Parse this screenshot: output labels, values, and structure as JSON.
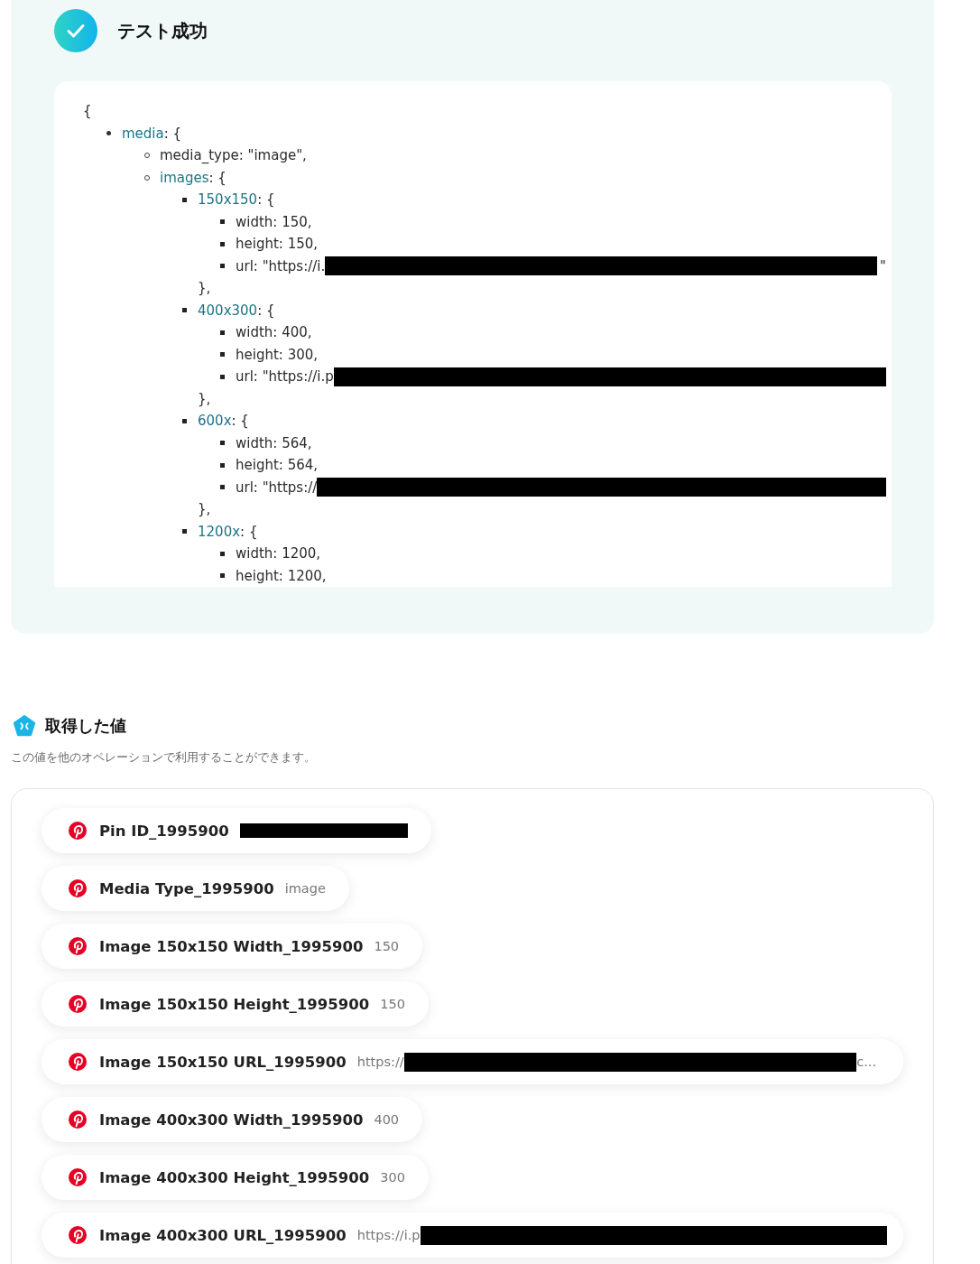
{
  "result": {
    "status_title": "テスト成功",
    "code": {
      "open": "{",
      "items": [
        {
          "key": "media",
          "text": ": {",
          "redacted": false,
          "children": [
            {
              "text": "media_type: \"image\",",
              "redacted": false
            },
            {
              "key": "images",
              "text": ": {",
              "redacted": false,
              "children": [
                {
                  "key": "150x150",
                  "text": ": {",
                  "redacted": false,
                  "close": "},",
                  "children": [
                    {
                      "text": "width: 150,",
                      "redacted": false
                    },
                    {
                      "text": "height: 150,",
                      "redacted": false
                    },
                    {
                      "text": "url: \"https://i.",
                      "redacted": true,
                      "suffix": "\""
                    }
                  ]
                },
                {
                  "key": "400x300",
                  "text": ": {",
                  "redacted": false,
                  "close": "},",
                  "children": [
                    {
                      "text": "width: 400,",
                      "redacted": false
                    },
                    {
                      "text": "height: 300,",
                      "redacted": false
                    },
                    {
                      "text": "url: \"https://i.p",
                      "redacted": true
                    }
                  ]
                },
                {
                  "key": "600x",
                  "text": ": {",
                  "redacted": false,
                  "close": "},",
                  "children": [
                    {
                      "text": "width: 564,",
                      "redacted": false
                    },
                    {
                      "text": "height: 564,",
                      "redacted": false
                    },
                    {
                      "text": "url: \"https://",
                      "redacted": true
                    }
                  ]
                },
                {
                  "key": "1200x",
                  "text": ": {",
                  "redacted": false,
                  "children": [
                    {
                      "text": "width: 1200,",
                      "redacted": false
                    },
                    {
                      "text": "height: 1200,",
                      "redacted": false
                    }
                  ]
                }
              ]
            }
          ]
        }
      ]
    }
  },
  "values": {
    "title": "取得した値",
    "subtitle": "この値を他のオペレーションで利用することができます。",
    "items": [
      {
        "kind": "id",
        "label": "Pin ID_1995900"
      },
      {
        "kind": "text",
        "label": "Media Type_1995900",
        "value": "image"
      },
      {
        "kind": "text",
        "label": "Image 150x150 Width_1995900",
        "value": "150"
      },
      {
        "kind": "text",
        "label": "Image 150x150 Height_1995900",
        "value": "150"
      },
      {
        "kind": "url",
        "label": "Image 150x150 URL_1995900",
        "value": "https://",
        "suffix": "c..."
      },
      {
        "kind": "text",
        "label": "Image 400x300 Width_1995900",
        "value": "400"
      },
      {
        "kind": "text",
        "label": "Image 400x300 Height_1995900",
        "value": "300"
      },
      {
        "kind": "url",
        "label": "Image 400x300 URL_1995900",
        "value": "https://i.p"
      }
    ]
  }
}
